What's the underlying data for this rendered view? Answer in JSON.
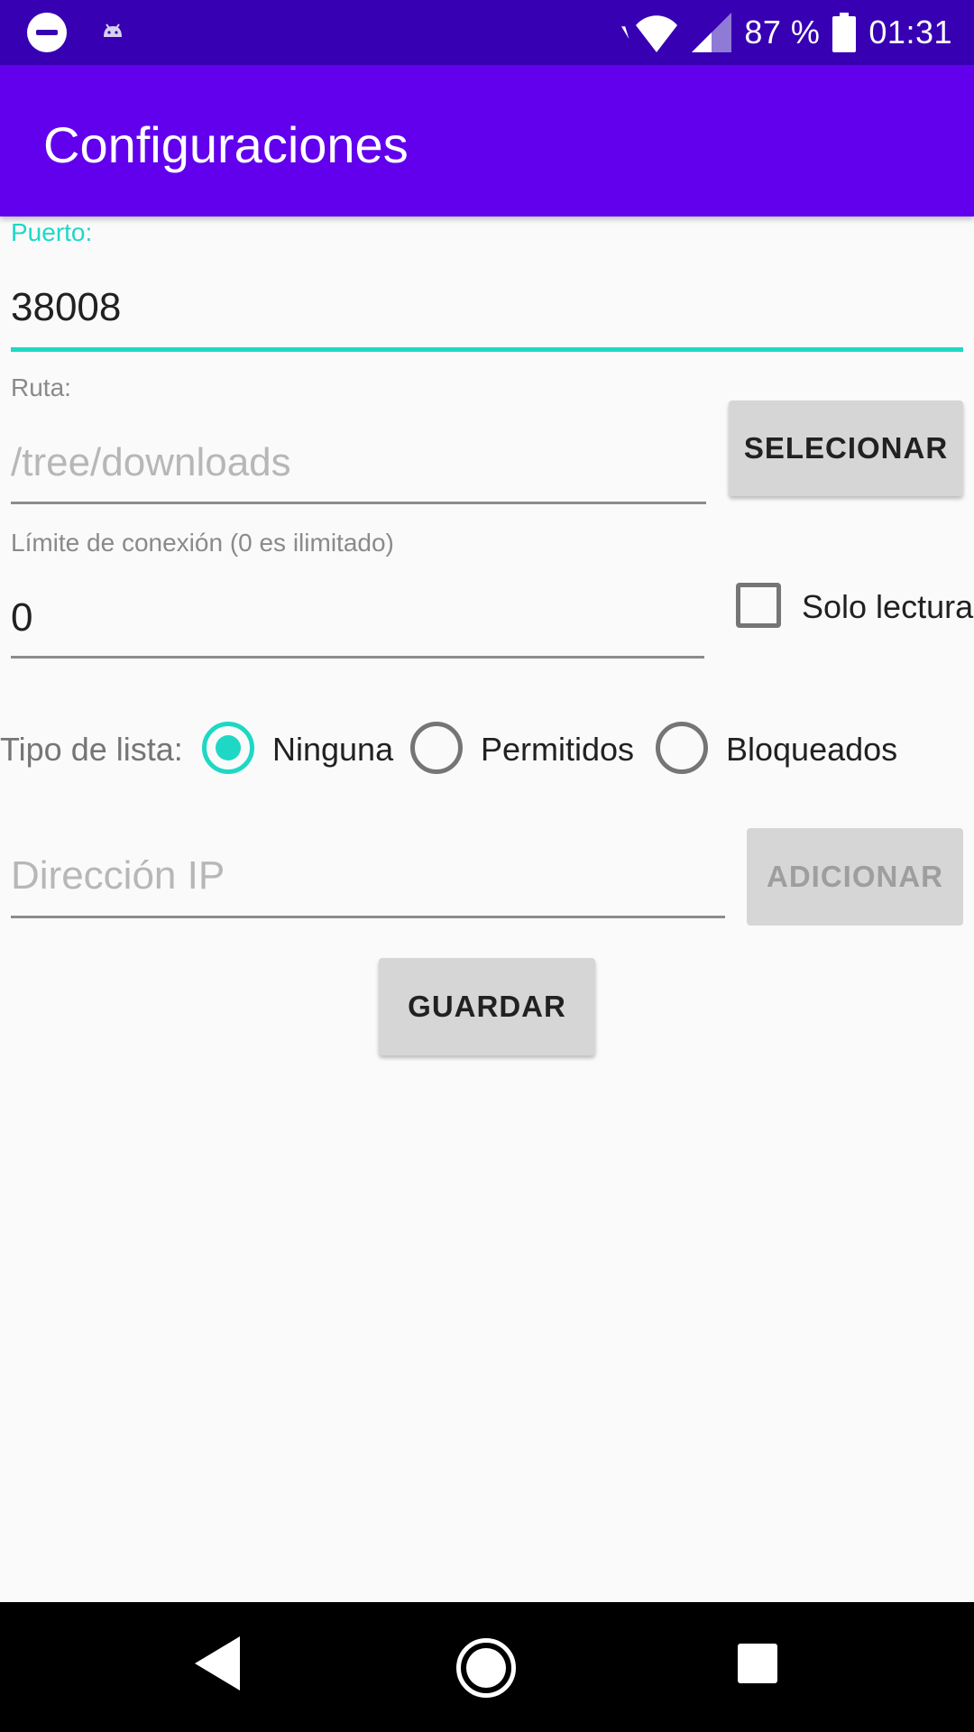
{
  "status_bar": {
    "battery": "87 %",
    "time": "01:31"
  },
  "app_bar": {
    "title": "Configuraciones"
  },
  "form": {
    "port": {
      "label": "Puerto:",
      "value": "38008"
    },
    "path": {
      "label": "Ruta:",
      "placeholder": "/tree/downloads",
      "button": "SELECIONAR"
    },
    "limit": {
      "label": "Límite de conexión (0 es ilimitado)",
      "value": "0",
      "readonly_label": "Solo lectura",
      "readonly_checked": false
    },
    "list_type": {
      "label": "Tipo de lista:",
      "options": [
        "Ninguna",
        "Permitidos",
        "Bloqueados"
      ],
      "selected": "Ninguna"
    },
    "ip": {
      "placeholder": "Dirección IP",
      "button": "ADICIONAR"
    },
    "save_button": "GUARDAR"
  },
  "colors": {
    "status_bar": "#3700b3",
    "app_bar": "#6200ee",
    "accent": "#1ed8c5"
  }
}
